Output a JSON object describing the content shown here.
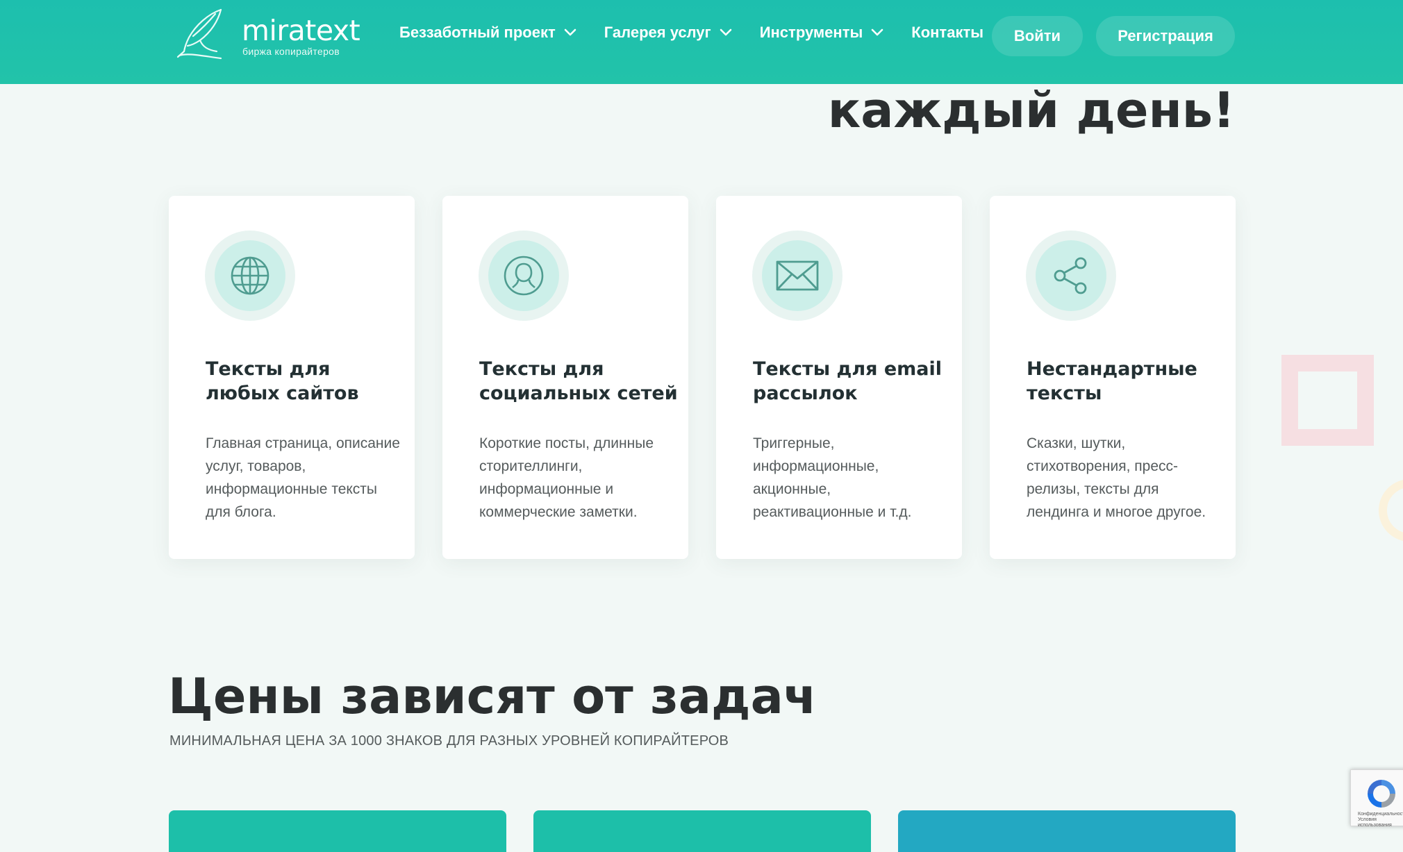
{
  "header": {
    "logo": {
      "name": "miratext",
      "subtitle": "биржа копирайтеров",
      "icon": "quill-pen-icon"
    },
    "nav": [
      {
        "label": "Беззаботный проект",
        "has_dropdown": true
      },
      {
        "label": "Галерея услуг",
        "has_dropdown": true
      },
      {
        "label": "Инструменты",
        "has_dropdown": true
      },
      {
        "label": "Контакты",
        "has_dropdown": false
      }
    ],
    "login_label": "Войти",
    "register_label": "Регистрация"
  },
  "hero": {
    "heading_tail": "каждый день!"
  },
  "cards": [
    {
      "icon": "globe-icon",
      "title": "Тексты для любых сайтов",
      "text": "Главная страница, описание услуг, товаров, информационные тексты для блога."
    },
    {
      "icon": "user-icon",
      "title": "Тексты для социальных сетей",
      "text": "Короткие посты, длинные сторителлинги, информационные и коммерческие заметки."
    },
    {
      "icon": "envelope-icon",
      "title": "Тексты для email рассылок",
      "text": "Триггерные, информационные, акционные, реактивационные и т.д."
    },
    {
      "icon": "share-icon",
      "title": "Нестандартные тексты",
      "text": "Сказки, шутки, стихотворения, пресс-релизы, тексты для лендинга и многое другое."
    }
  ],
  "pricing": {
    "title": "Цены зависят от задач",
    "subtitle": "МИНИМАЛЬНАЯ ЦЕНА ЗА 1000 ЗНАКОВ ДЛЯ РАЗНЫХ УРОВНЕЙ КОПИРАЙТЕРОВ"
  },
  "recaptcha": {
    "text": "Конфиденциальность - Условия использования"
  },
  "colors": {
    "header": "#1dbfae",
    "background": "#f2f8f6",
    "icon_stroke": "#4f9c90",
    "price_card_teal": "#1dbfa9",
    "price_card_blue": "#23a8c2"
  }
}
